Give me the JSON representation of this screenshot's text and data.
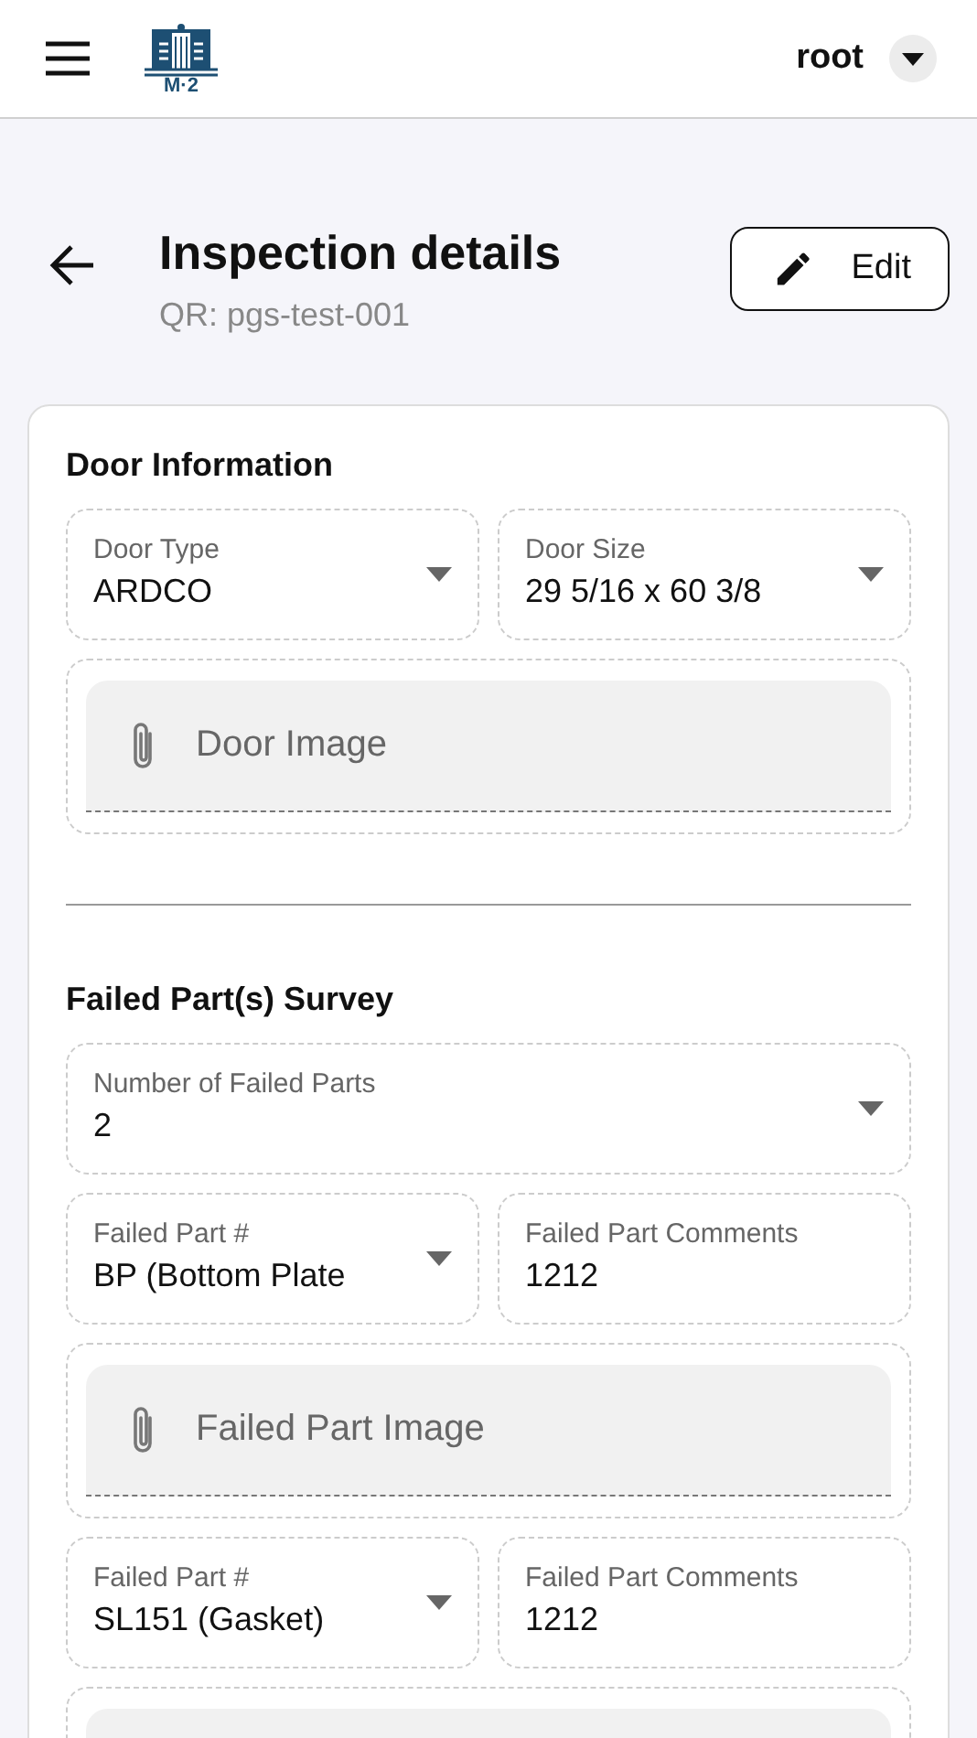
{
  "header": {
    "logo_text": "M·2",
    "user": "root"
  },
  "page": {
    "title": "Inspection details",
    "subtitle": "QR: pgs-test-001",
    "edit_button": "Edit"
  },
  "sections": [
    {
      "title": "Door Information",
      "rows": [
        [
          {
            "kind": "select",
            "label": "Door Type",
            "value": "ARDCO"
          },
          {
            "kind": "select",
            "label": "Door Size",
            "value": "29 5/16 x 60 3/8"
          }
        ],
        [
          {
            "kind": "image",
            "label": "Door Image"
          }
        ]
      ]
    },
    {
      "title": "Failed Part(s) Survey",
      "rows": [
        [
          {
            "kind": "select",
            "label": "Number of Failed Parts",
            "value": "2"
          }
        ],
        [
          {
            "kind": "select",
            "label": "Failed Part #",
            "value": "BP (Bottom Plate"
          },
          {
            "kind": "text",
            "label": "Failed Part Comments",
            "value": "1212"
          }
        ],
        [
          {
            "kind": "image",
            "label": "Failed Part Image"
          }
        ],
        [
          {
            "kind": "select",
            "label": "Failed Part #",
            "value": "SL151 (Gasket)"
          },
          {
            "kind": "text",
            "label": "Failed Part Comments",
            "value": "1212"
          }
        ],
        [
          {
            "kind": "image"
          }
        ]
      ]
    }
  ]
}
